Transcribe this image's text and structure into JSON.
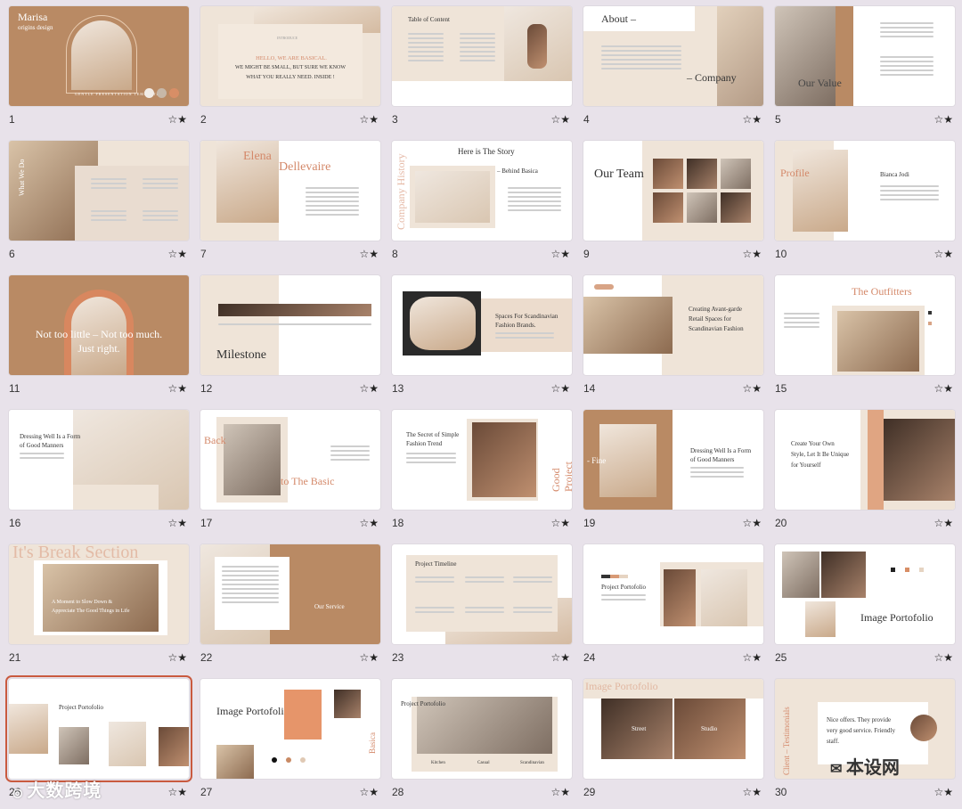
{
  "slides": [
    {
      "num": "1",
      "title": "Marisa",
      "subtitle": "origins design",
      "caption": "GENTLE PRESENTATION TEMPLATE"
    },
    {
      "num": "2",
      "eyebrow": "INTRODUCE",
      "line1": "HELLO, WE ARE BASICAL.",
      "line2": "WE MIGHT BE SMALL, BUT SURE WE KNOW",
      "line3": "WHAT YOU REALLY NEED. INSIDE !"
    },
    {
      "num": "3",
      "title": "Table of Content"
    },
    {
      "num": "4",
      "title": "About –",
      "subtitle": "– Company"
    },
    {
      "num": "5",
      "title": "Our Value"
    },
    {
      "num": "6",
      "title": "What We Do"
    },
    {
      "num": "7",
      "title1": "Elena",
      "title2": "Dellevaire"
    },
    {
      "num": "8",
      "title": "Here is The Story",
      "subtitle": "– Behind Basica",
      "vertical": "Company History"
    },
    {
      "num": "9",
      "title": "Our Team"
    },
    {
      "num": "10",
      "title": "Profile",
      "name": "Bianca Jodi"
    },
    {
      "num": "11",
      "line1": "Not too little – Not too much.",
      "line2": "Just right."
    },
    {
      "num": "12",
      "title": "Milestone"
    },
    {
      "num": "13",
      "line1": "Spaces For Scandinavian",
      "line2": "Fashion Brands."
    },
    {
      "num": "14",
      "line1": "Creating Avant-garde",
      "line2": "Retail Spaces for",
      "line3": "Scandinavian Fashion"
    },
    {
      "num": "15",
      "title": "The Outfitters"
    },
    {
      "num": "16",
      "line1": "Dressing Well Is a Form",
      "line2": "of Good Manners"
    },
    {
      "num": "17",
      "title1": "Back",
      "title2": "to The Basic"
    },
    {
      "num": "18",
      "line1": "The Secret of Simple",
      "line2": "Fashion Trend",
      "vertical": "Good Project"
    },
    {
      "num": "19",
      "line1": "Dressing Well Is a Form",
      "line2": "of Good Manners",
      "side": "- Fine"
    },
    {
      "num": "20",
      "line1": "Create Your Own",
      "line2": "Style, Let It Be Unique",
      "line3": "for Yourself"
    },
    {
      "num": "21",
      "title": "It's Break Section",
      "line1": "A Moment to Slow Down &",
      "line2": "Appreciate The Good Things in Life"
    },
    {
      "num": "22",
      "title": "Our Service"
    },
    {
      "num": "23",
      "title": "Project Timeline"
    },
    {
      "num": "24",
      "title": "Project Portofolio"
    },
    {
      "num": "25",
      "title": "Image Portofolio"
    },
    {
      "num": "26",
      "title": "Project Portofolio"
    },
    {
      "num": "27",
      "title": "Image Portofolio",
      "vertical": "Basica – Studio"
    },
    {
      "num": "28",
      "title": "Project Portofolio",
      "c1": "Kitchen",
      "c2": "Casual",
      "c3": "Scandinavian"
    },
    {
      "num": "29",
      "title": "Image Portofolio",
      "c1": "Street",
      "c2": "Studio"
    },
    {
      "num": "30",
      "vertical": "Client – Testimonials",
      "line1": "Nice offers. They provide",
      "line2": "very good service. Friendly",
      "line3": "staff."
    }
  ],
  "star_icon_label": "☆★",
  "selected": "26",
  "watermark_left": "大数跨境",
  "watermark_right": "本设网"
}
